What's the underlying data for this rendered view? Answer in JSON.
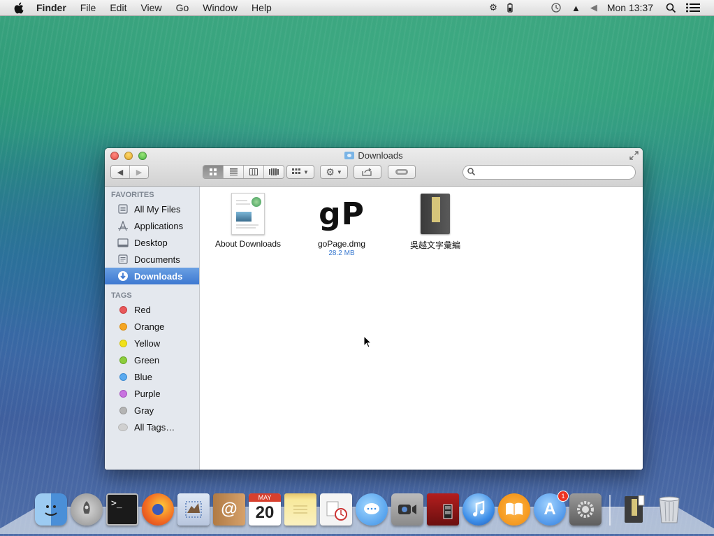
{
  "menubar": {
    "apple": "",
    "app": "Finder",
    "menus": [
      "File",
      "Edit",
      "View",
      "Go",
      "Window",
      "Help"
    ],
    "clock": "Mon 13:37"
  },
  "window": {
    "title": "Downloads",
    "search": {
      "placeholder": "",
      "value": ""
    }
  },
  "sidebar": {
    "favorites_header": "FAVORITES",
    "favorites": [
      {
        "label": "All My Files",
        "icon": "all-my-files-icon"
      },
      {
        "label": "Applications",
        "icon": "applications-icon"
      },
      {
        "label": "Desktop",
        "icon": "desktop-icon"
      },
      {
        "label": "Documents",
        "icon": "documents-icon"
      },
      {
        "label": "Downloads",
        "icon": "downloads-icon",
        "selected": true
      }
    ],
    "tags_header": "TAGS",
    "tags": [
      {
        "label": "Red",
        "color": "#e8585a"
      },
      {
        "label": "Orange",
        "color": "#f5a623"
      },
      {
        "label": "Yellow",
        "color": "#f1e11a"
      },
      {
        "label": "Green",
        "color": "#8ccd3c"
      },
      {
        "label": "Blue",
        "color": "#5aaaf0"
      },
      {
        "label": "Purple",
        "color": "#c873e0"
      },
      {
        "label": "Gray",
        "color": "#b4b4b4"
      },
      {
        "label": "All Tags…",
        "color": "#d0d0d0"
      }
    ]
  },
  "files": [
    {
      "name": "About Downloads",
      "size": ""
    },
    {
      "name": "goPage.dmg",
      "size": "28.2 MB",
      "icon_text": "gP"
    },
    {
      "name": "吳越文字彙編",
      "size": ""
    }
  ],
  "dock": {
    "apps": [
      "Finder",
      "Launchpad",
      "Terminal",
      "Firefox",
      "Mail",
      "Contacts",
      "Calendar",
      "Notes",
      "Reminders",
      "Messages",
      "FaceTime",
      "Photo Booth",
      "iTunes",
      "iBooks",
      "App Store",
      "System Preferences"
    ],
    "calendar_month": "MAY",
    "calendar_day": "20",
    "app_store_badge": "1"
  }
}
